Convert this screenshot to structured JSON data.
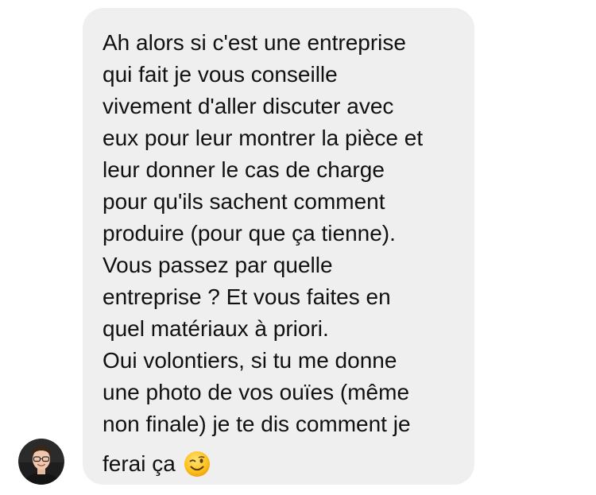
{
  "message": {
    "lines": [
      "Ah alors si c'est une entreprise",
      "qui fait je vous conseille",
      "vivement d'aller discuter avec",
      "eux pour leur montrer la pièce et",
      "leur donner le cas de charge",
      "pour qu'ils sachent comment",
      "produire (pour que ça tienne).",
      "Vous passez par quelle",
      "entreprise ? Et vous faites en",
      "quel matériaux à priori.",
      "Oui volontiers, si tu me donne",
      "une photo de vos ouïes (même",
      "non finale) je te dis comment je"
    ],
    "last_line": "ferai ça",
    "emoji_icon": "winking-face-emoji"
  },
  "colors": {
    "bubble_bg": "#efefef",
    "text": "#111111"
  },
  "sender": {
    "avatar_icon": "user-avatar-photo"
  }
}
